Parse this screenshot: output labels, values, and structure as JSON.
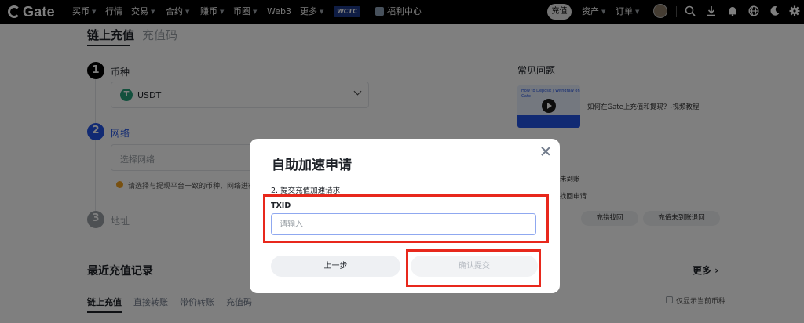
{
  "nav": {
    "logo": "Gate",
    "items": [
      {
        "label": "买币",
        "caret": true
      },
      {
        "label": "行情",
        "caret": false
      },
      {
        "label": "交易",
        "caret": true
      },
      {
        "label": "合约",
        "caret": true
      },
      {
        "label": "赚币",
        "caret": true
      },
      {
        "label": "币圈",
        "caret": true
      },
      {
        "label": "Web3",
        "caret": false
      },
      {
        "label": "更多",
        "caret": true
      }
    ],
    "wctc": "WCTC",
    "benefit": "福利中心",
    "deposit": "充值",
    "assets": "资产",
    "orders": "订单",
    "icons": [
      "search-icon",
      "download-icon",
      "bell-icon",
      "globe-icon",
      "moon-icon",
      "gear-icon"
    ]
  },
  "page": {
    "tabs": {
      "onchain": "链上充值",
      "code": "充值码"
    },
    "steps": {
      "s1": {
        "num": "1",
        "label": "币种"
      },
      "s2": {
        "num": "2",
        "label": "网络"
      },
      "s3": {
        "num": "3",
        "label": "地址"
      }
    },
    "coin": {
      "symbol": "T",
      "name": "USDT"
    },
    "network_placeholder": "选择网络",
    "warning": "请选择与提现平台一致的币种、网络进行充值",
    "recent": {
      "title": "最近充值记录",
      "more": "更多",
      "tabs": [
        "链上充值",
        "直接转账",
        "带价转账",
        "充值码"
      ],
      "only_current": "仅显示当前币种"
    }
  },
  "faq": {
    "title": "常见问题",
    "video_label": "如何在Gate上充值和提现？-视频教程",
    "thumb_text": "How to Deposit / Withdraw on Gate",
    "link1": "未到账",
    "link2": "找回申请",
    "btn1": "充错找回",
    "btn2": "充值未到账退回"
  },
  "modal": {
    "title": "自助加速申请",
    "step": "2. 提交充值加速请求",
    "txid_label": "TXID",
    "txid_placeholder": "请输入",
    "prev": "上一步",
    "confirm": "确认提交"
  },
  "colors": {
    "nav_bg": "#000000",
    "accent_blue": "#2354e6",
    "highlight_red": "#e8281c",
    "usdt_green": "#26a17b",
    "warning": "#f0a020"
  }
}
